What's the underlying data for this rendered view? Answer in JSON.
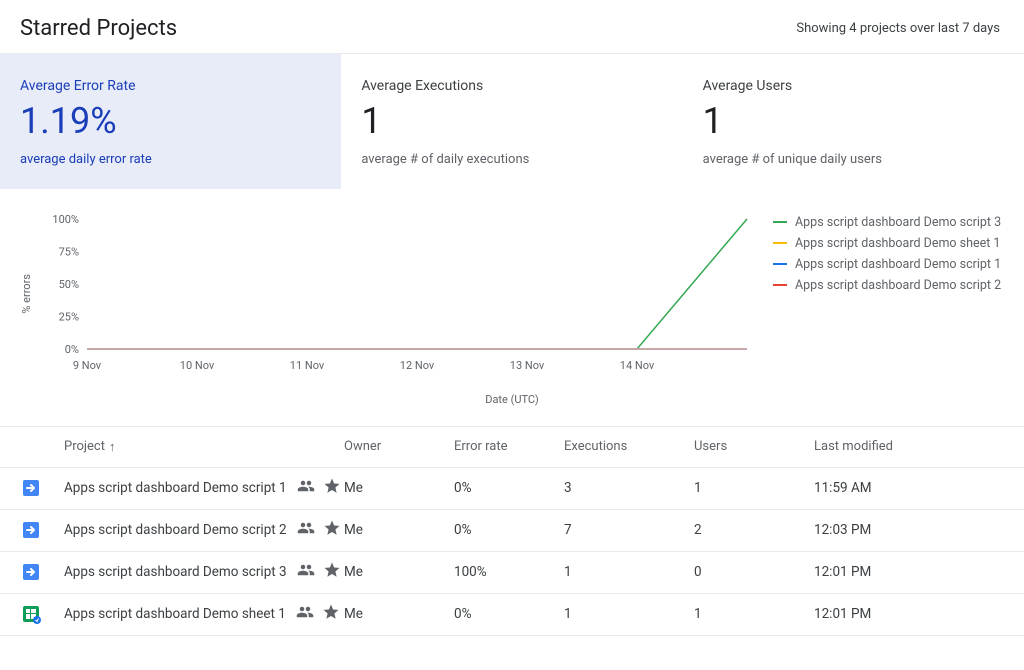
{
  "header": {
    "title": "Starred Projects",
    "summary": "Showing 4 projects over last 7 days"
  },
  "stats": [
    {
      "label": "Average Error Rate",
      "value": "1.19%",
      "desc": "average daily error rate",
      "active": true
    },
    {
      "label": "Average Executions",
      "value": "1",
      "desc": "average # of daily executions",
      "active": false
    },
    {
      "label": "Average Users",
      "value": "1",
      "desc": "average # of unique daily users",
      "active": false
    }
  ],
  "chart_data": {
    "type": "line",
    "ylabel": "% errors",
    "xlabel": "Date (UTC)",
    "ylim": [
      0,
      100
    ],
    "x_categories": [
      "9 Nov",
      "10 Nov",
      "11 Nov",
      "12 Nov",
      "13 Nov",
      "14 Nov"
    ],
    "y_ticks": [
      0,
      25,
      50,
      75,
      100
    ],
    "series": [
      {
        "name": "Apps script dashboard Demo script 3",
        "color": "#34a853",
        "values": [
          0,
          0,
          0,
          0,
          0,
          0,
          100
        ]
      },
      {
        "name": "Apps script dashboard Demo sheet 1",
        "color": "#fbbc04",
        "values": [
          0,
          0,
          0,
          0,
          0,
          0,
          0
        ]
      },
      {
        "name": "Apps script dashboard Demo script 1",
        "color": "#1a73e8",
        "values": [
          0,
          0,
          0,
          0,
          0,
          0,
          0
        ]
      },
      {
        "name": "Apps script dashboard Demo script 2",
        "color": "#ea4335",
        "values": [
          0,
          0,
          0,
          0,
          0,
          0,
          0
        ]
      }
    ]
  },
  "table": {
    "columns": {
      "project": "Project",
      "owner": "Owner",
      "error_rate": "Error rate",
      "executions": "Executions",
      "users": "Users",
      "last_modified": "Last modified"
    },
    "sort_arrow": "↑",
    "rows": [
      {
        "icon": "script",
        "name": "Apps script dashboard Demo script 1",
        "owner": "Me",
        "error_rate": "0%",
        "executions": "3",
        "users": "1",
        "last_modified": "11:59 AM"
      },
      {
        "icon": "script",
        "name": "Apps script dashboard Demo script 2",
        "owner": "Me",
        "error_rate": "0%",
        "executions": "7",
        "users": "2",
        "last_modified": "12:03 PM"
      },
      {
        "icon": "script",
        "name": "Apps script dashboard Demo script 3",
        "owner": "Me",
        "error_rate": "100%",
        "executions": "1",
        "users": "0",
        "last_modified": "12:01 PM"
      },
      {
        "icon": "sheet",
        "name": "Apps script dashboard Demo sheet 1",
        "owner": "Me",
        "error_rate": "0%",
        "executions": "1",
        "users": "1",
        "last_modified": "12:01 PM"
      }
    ]
  }
}
